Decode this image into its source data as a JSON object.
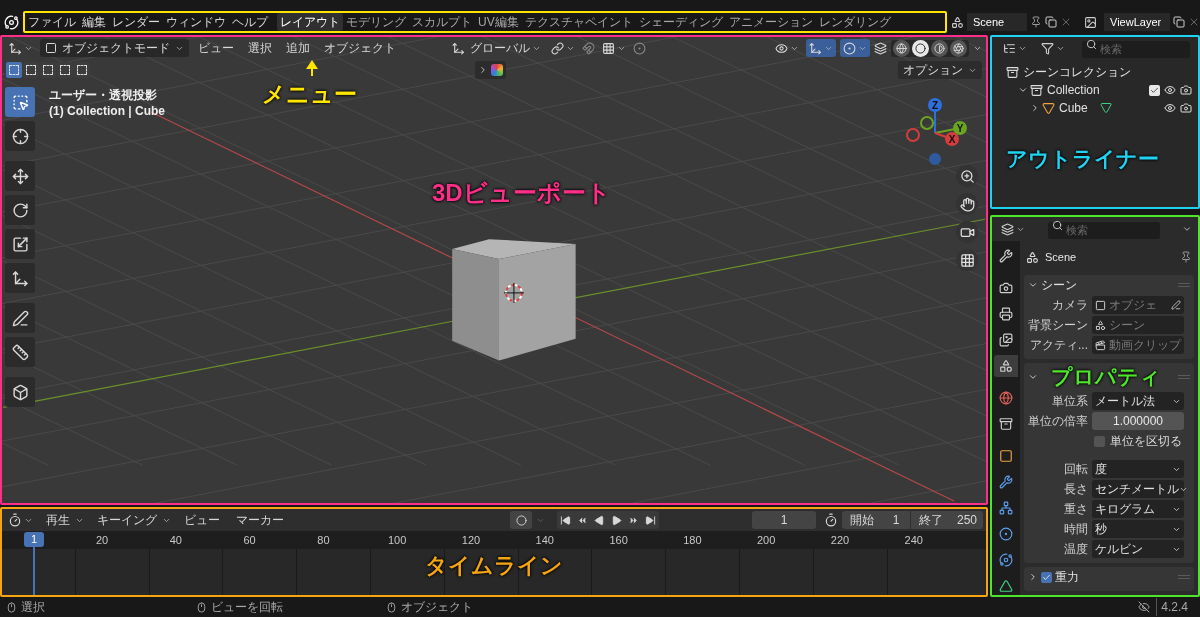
{
  "topbar": {
    "menus": [
      "ファイル",
      "編集",
      "レンダー",
      "ウィンドウ",
      "ヘルプ"
    ],
    "workspaces": [
      {
        "label": "レイアウト",
        "selected": true
      },
      {
        "label": "モデリング",
        "selected": false
      },
      {
        "label": "スカルプト",
        "selected": false
      },
      {
        "label": "UV編集",
        "selected": false
      },
      {
        "label": "テクスチャペイント",
        "selected": false
      },
      {
        "label": "シェーディング",
        "selected": false
      },
      {
        "label": "アニメーション",
        "selected": false
      },
      {
        "label": "レンダリング",
        "selected": false
      }
    ],
    "scene": "Scene",
    "view_layer": "ViewLayer"
  },
  "viewport": {
    "mode": "オブジェクトモード",
    "menus": [
      "ビュー",
      "選択",
      "追加",
      "オブジェクト"
    ],
    "orientation": "グローバル",
    "options": "オプション",
    "view_name": "ユーザー・透視投影",
    "view_info": "(1) Collection | Cube",
    "select_modes": [
      {
        "selected": true
      },
      {
        "selected": false
      },
      {
        "selected": false
      },
      {
        "selected": false
      },
      {
        "selected": false
      }
    ],
    "tools": [
      {
        "kind": "select",
        "selected": true
      },
      {
        "kind": "cursor",
        "selected": false
      },
      {
        "kind": "move",
        "selected": false
      },
      {
        "kind": "rotate",
        "selected": false
      },
      {
        "kind": "scale",
        "selected": false
      },
      {
        "kind": "transform",
        "selected": false
      },
      {
        "kind": "annotate",
        "selected": false
      },
      {
        "kind": "measure",
        "selected": false
      },
      {
        "kind": "add-cube",
        "selected": false
      }
    ],
    "shading": [
      {
        "kind": "wireframe",
        "selected": false
      },
      {
        "kind": "solid",
        "selected": true
      },
      {
        "kind": "material",
        "selected": false
      },
      {
        "kind": "rendered",
        "selected": false
      }
    ],
    "axis_labels": [
      "Z",
      "Y",
      "X"
    ]
  },
  "outliner": {
    "search_placeholder": "検索",
    "root": {
      "label": "シーンコレクション",
      "children": [
        {
          "label": "Collection",
          "expanded": true,
          "checked": true,
          "children": [
            {
              "label": "Cube",
              "expanded": false
            }
          ]
        }
      ]
    }
  },
  "properties": {
    "search_placeholder": "検索",
    "title": "Scene",
    "tabs": [
      {
        "kind": "tool",
        "selected": false
      },
      {
        "kind": "render",
        "selected": false
      },
      {
        "kind": "output",
        "selected": false
      },
      {
        "kind": "view-layer",
        "selected": false
      },
      {
        "kind": "scene",
        "selected": true
      },
      {
        "kind": "world",
        "selected": false
      },
      {
        "kind": "collection",
        "selected": false
      },
      {
        "kind": "object",
        "selected": false
      },
      {
        "kind": "modifier",
        "selected": false
      },
      {
        "kind": "particles",
        "selected": false
      },
      {
        "kind": "physics",
        "selected": false
      },
      {
        "kind": "constraints",
        "selected": false
      },
      {
        "kind": "data",
        "selected": false
      }
    ],
    "panels": [
      {
        "title": "シーン",
        "expanded": true,
        "rows": [
          {
            "kind": "datablock",
            "label": "カメラ",
            "placeholder": "オブジェ"
          },
          {
            "kind": "datablock",
            "label": "背景シーン",
            "placeholder": "シーン"
          },
          {
            "kind": "datablock",
            "label": "アクティ...",
            "placeholder": "動画クリップ"
          }
        ]
      },
      {
        "expanded": true,
        "rows": [
          {
            "kind": "dropdown",
            "label": "単位系",
            "value": "メートル法"
          },
          {
            "kind": "number",
            "label": "単位の倍率",
            "value": "1.000000"
          },
          {
            "kind": "checkbox",
            "label": "単位を区切る",
            "checked": false
          },
          {
            "kind": "dropdown",
            "label": "回転",
            "value": "度"
          },
          {
            "kind": "dropdown",
            "label": "長さ",
            "value": "センチメートル"
          },
          {
            "kind": "dropdown",
            "label": "重さ",
            "value": "キログラム"
          },
          {
            "kind": "dropdown",
            "label": "時間",
            "value": "秒"
          },
          {
            "kind": "dropdown",
            "label": "温度",
            "value": "ケルビン"
          }
        ]
      },
      {
        "title": "重力",
        "expanded": false,
        "checked": true
      }
    ]
  },
  "timeline": {
    "menus": [
      "再生",
      "キーイング",
      "ビュー",
      "マーカー"
    ],
    "current_frame": "1",
    "start_label": "開始",
    "start": "1",
    "end_label": "終了",
    "end": "250",
    "playhead": "1",
    "ticks": [
      "20",
      "40",
      "60",
      "80",
      "100",
      "120",
      "140",
      "160",
      "180",
      "200",
      "220",
      "240"
    ]
  },
  "status_bar": {
    "items": [
      "選択",
      "ビューを回転",
      "オブジェクト"
    ],
    "version": "4.2.4"
  },
  "annotations": [
    {
      "label": "メニュー",
      "color": "#ffe500"
    },
    {
      "label": "3Dビューポート",
      "color": "#ff2e88"
    },
    {
      "label": "アウトライナー",
      "color": "#1ed2f0"
    },
    {
      "label": "プロパティ",
      "color": "#4ee62a"
    },
    {
      "label": "タイムライン",
      "color": "#f5a511"
    }
  ]
}
